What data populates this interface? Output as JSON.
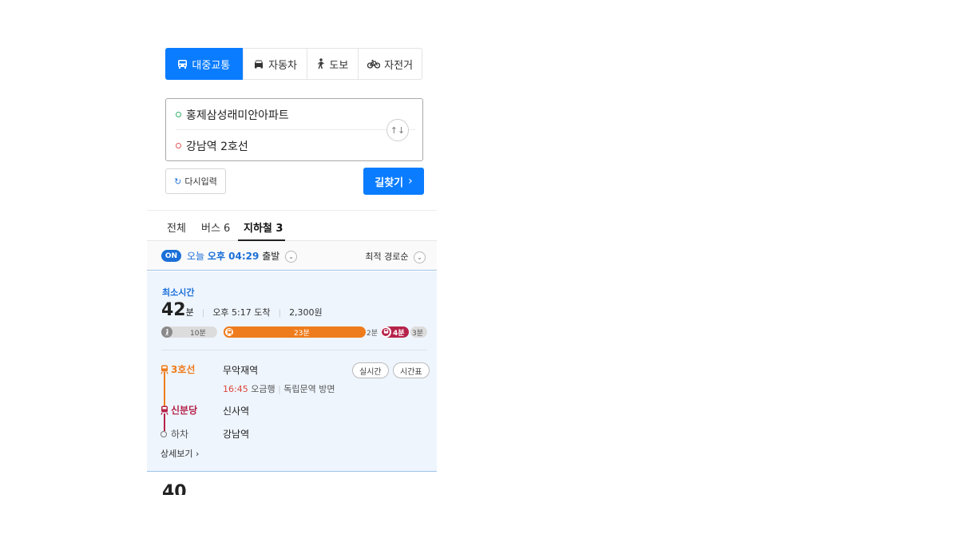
{
  "mode_tabs": [
    {
      "label": "대중교통",
      "icon": "bus-icon",
      "active": true
    },
    {
      "label": "자동차",
      "icon": "car-icon",
      "active": false
    },
    {
      "label": "도보",
      "icon": "walk-icon",
      "active": false
    },
    {
      "label": "자전거",
      "icon": "bicycle-icon",
      "active": false
    }
  ],
  "route": {
    "origin": "홍제삼성래미안아파트",
    "destination": "강남역 2호선",
    "swap_icon": "↑↓"
  },
  "buttons": {
    "reset": "다시입력",
    "reset_icon": "↻",
    "search": "길찾기",
    "search_chevron": "›"
  },
  "type_tabs": {
    "all": "전체",
    "bus": "버스 6",
    "subway": "지하철 3"
  },
  "departure": {
    "badge": "ON",
    "today": "오늘",
    "time": "오후 04:29",
    "suffix": "출발",
    "chevron": "⌄",
    "sort_label": "최적 경로순"
  },
  "result": {
    "tag": "최소시간",
    "minutes": "42",
    "minutes_unit": "분",
    "arrival": "오후 5:17 도착",
    "fare": "2,300원",
    "timeline": {
      "walk_start": "10분",
      "line3": "23분",
      "transfer_walk": "2분",
      "shinbundang": "4분",
      "walk_end": "3분"
    },
    "steps": [
      {
        "line": "3호선",
        "station": "무악재역",
        "color": "#ef7c1c"
      },
      {
        "line": "신분당",
        "station": "신사역",
        "color": "#b6234a"
      },
      {
        "line": "하차",
        "station": "강남역",
        "color": "#666666"
      }
    ],
    "realtime_btn": "실시간",
    "timetable_btn": "시간표",
    "dir_time": "16:45",
    "dir_type": "오금행",
    "dir_toward": "독립문역 방면",
    "detail_link": "상세보기 ›"
  },
  "next_result_peek": "40",
  "colors": {
    "primary": "#0a7cff",
    "line3": "#ef7c1c",
    "shinbundang": "#b6234a",
    "card_bg": "#eef5fd"
  }
}
